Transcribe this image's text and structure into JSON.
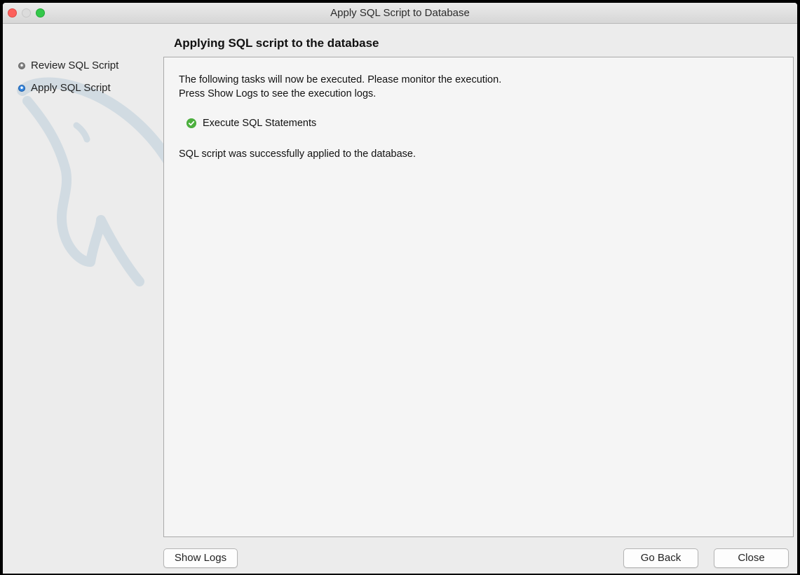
{
  "window": {
    "title": "Apply SQL Script to Database"
  },
  "sidebar": {
    "steps": [
      {
        "label": "Review SQL Script",
        "state": "done"
      },
      {
        "label": "Apply SQL Script",
        "state": "current"
      }
    ]
  },
  "page": {
    "title": "Applying SQL script to the database",
    "intro_line1": "The following tasks will now be executed. Please monitor the execution.",
    "intro_line2": "Press Show Logs to see the execution logs.",
    "tasks": [
      {
        "label": "Execute SQL Statements",
        "status": "success",
        "icon": "check-circle-icon"
      }
    ],
    "result": "SQL script was successfully applied to the database."
  },
  "buttons": {
    "show_logs": "Show Logs",
    "go_back": "Go Back",
    "close": "Close"
  },
  "colors": {
    "success": "#4caf3e",
    "current_step": "#3f8fe6",
    "close_light": "#fc605c",
    "maximize_light": "#34c84a"
  }
}
